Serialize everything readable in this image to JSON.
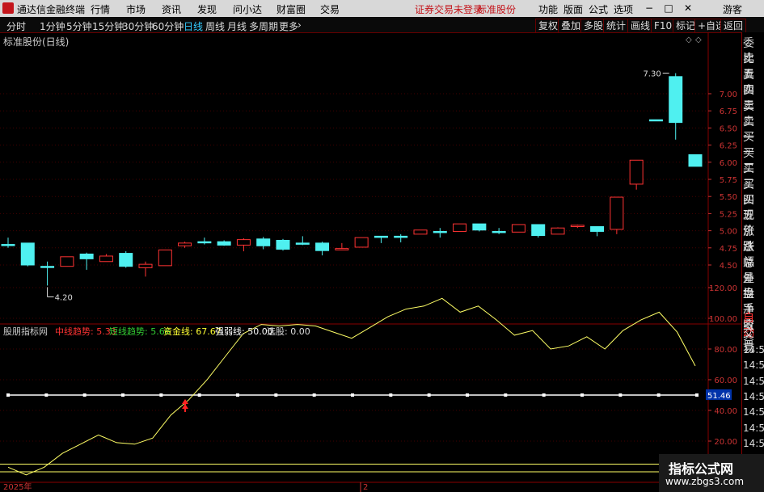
{
  "titlebar": {
    "app_name": "通达信金融终端",
    "menus": [
      "行情",
      "市场",
      "资讯",
      "发现",
      "问小达",
      "财富圈",
      "交易"
    ],
    "warning": "证券交易未登录",
    "stock_label": "标准股份",
    "right_menus": [
      "功能",
      "版面",
      "公式",
      "选项"
    ],
    "user": "游客"
  },
  "periods": {
    "items": [
      "分时",
      "1分钟",
      "5分钟",
      "15分钟",
      "30分钟",
      "60分钟",
      "日线",
      "周线",
      "月线",
      "多周期",
      "更多"
    ],
    "active": "日线"
  },
  "tools": [
    "复权",
    "叠加",
    "多股",
    "统计",
    "画线",
    "F10",
    "标记",
    "+自选",
    "返回"
  ],
  "stock_title": "标准股份(日线)",
  "right_panel": {
    "top_items": [
      "委比",
      "卖五",
      "卖四",
      "卖三",
      "卖二",
      "卖一",
      "买一",
      "买二",
      "买三",
      "买四",
      "买五",
      "现价",
      "涨跌",
      "涨幅",
      "总量",
      "外盘",
      "换手",
      "净资",
      "收益"
    ],
    "bottom_items": [
      "自动",
      "交易",
      "14:56",
      "14:56",
      "14:56",
      "14:56",
      "14:56",
      "14:56",
      "14:56",
      "14:56",
      "14:56"
    ]
  },
  "price_axis": [
    "7.00",
    "6.75",
    "6.50",
    "6.25",
    "6.00",
    "5.75",
    "5.50",
    "5.25",
    "5.00",
    "4.75",
    "4.50"
  ],
  "annotations": {
    "high": "7.30",
    "low": "4.20"
  },
  "indicator": {
    "name": "股朋指标网",
    "items": [
      {
        "label": "中线趋势: 5.33",
        "color": "#ff3333"
      },
      {
        "label": "短线趋势: 5.66",
        "color": "#33cc33"
      },
      {
        "label": "资金线: 67.67",
        "color": "#ffff33"
      },
      {
        "label": "强弱线: 50.00",
        "color": "#ffffff"
      },
      {
        "label": "选股: 0.00",
        "color": "#dddddd"
      }
    ],
    "axis": [
      "120.00",
      "100.00",
      "80.00",
      "60.00",
      "40.00",
      "20.00"
    ],
    "current": "51.46"
  },
  "date_labels": {
    "start": "2025年",
    "mid": "2"
  },
  "watermark": {
    "line1": "指标公式网",
    "line2": "www.zbgs3.com"
  },
  "chart_data": {
    "type": "candlestick",
    "candles": [
      {
        "o": 4.8,
        "c": 4.8,
        "h": 4.9,
        "l": 4.75,
        "up": false
      },
      {
        "o": 4.82,
        "c": 4.5,
        "h": 4.82,
        "l": 4.48,
        "up": false
      },
      {
        "o": 4.48,
        "c": 4.48,
        "h": 4.55,
        "l": 4.2,
        "up": false
      },
      {
        "o": 4.48,
        "c": 4.62,
        "h": 4.62,
        "l": 4.48,
        "up": true
      },
      {
        "o": 4.66,
        "c": 4.59,
        "h": 4.68,
        "l": 4.43,
        "up": false
      },
      {
        "o": 4.55,
        "c": 4.63,
        "h": 4.66,
        "l": 4.55,
        "up": true
      },
      {
        "o": 4.67,
        "c": 4.48,
        "h": 4.7,
        "l": 4.46,
        "up": false
      },
      {
        "o": 4.46,
        "c": 4.51,
        "h": 4.55,
        "l": 4.33,
        "up": true
      },
      {
        "o": 4.49,
        "c": 4.72,
        "h": 4.72,
        "l": 4.49,
        "up": true
      },
      {
        "o": 4.78,
        "c": 4.82,
        "h": 4.84,
        "l": 4.75,
        "up": true
      },
      {
        "o": 4.84,
        "c": 4.84,
        "h": 4.9,
        "l": 4.8,
        "up": false
      },
      {
        "o": 4.84,
        "c": 4.79,
        "h": 4.86,
        "l": 4.78,
        "up": false
      },
      {
        "o": 4.79,
        "c": 4.87,
        "h": 4.89,
        "l": 4.7,
        "up": true
      },
      {
        "o": 4.88,
        "c": 4.78,
        "h": 4.91,
        "l": 4.73,
        "up": false
      },
      {
        "o": 4.86,
        "c": 4.73,
        "h": 4.88,
        "l": 4.71,
        "up": false
      },
      {
        "o": 4.82,
        "c": 4.82,
        "h": 4.92,
        "l": 4.79,
        "up": false
      },
      {
        "o": 4.82,
        "c": 4.71,
        "h": 4.84,
        "l": 4.64,
        "up": false
      },
      {
        "o": 4.72,
        "c": 4.74,
        "h": 4.82,
        "l": 4.72,
        "up": true
      },
      {
        "o": 4.76,
        "c": 4.9,
        "h": 4.9,
        "l": 4.76,
        "up": true
      },
      {
        "o": 4.92,
        "c": 4.92,
        "h": 4.92,
        "l": 4.82,
        "up": false
      },
      {
        "o": 4.92,
        "c": 4.92,
        "h": 4.95,
        "l": 4.83,
        "up": false
      },
      {
        "o": 4.95,
        "c": 5.01,
        "h": 5.01,
        "l": 4.95,
        "up": true
      },
      {
        "o": 4.99,
        "c": 4.99,
        "h": 5.04,
        "l": 4.9,
        "up": false
      },
      {
        "o": 4.99,
        "c": 5.1,
        "h": 5.1,
        "l": 4.99,
        "up": true
      },
      {
        "o": 5.1,
        "c": 5.01,
        "h": 5.1,
        "l": 4.99,
        "up": false
      },
      {
        "o": 4.99,
        "c": 4.99,
        "h": 5.04,
        "l": 4.95,
        "up": false
      },
      {
        "o": 4.98,
        "c": 5.09,
        "h": 5.09,
        "l": 4.98,
        "up": true
      },
      {
        "o": 5.09,
        "c": 4.93,
        "h": 5.09,
        "l": 4.9,
        "up": false
      },
      {
        "o": 4.95,
        "c": 5.04,
        "h": 5.05,
        "l": 4.95,
        "up": true
      },
      {
        "o": 5.06,
        "c": 5.08,
        "h": 5.09,
        "l": 5.04,
        "up": true
      },
      {
        "o": 5.06,
        "c": 4.99,
        "h": 5.06,
        "l": 4.92,
        "up": false
      },
      {
        "o": 5.02,
        "c": 5.49,
        "h": 5.49,
        "l": 4.95,
        "up": true
      },
      {
        "o": 5.68,
        "c": 6.03,
        "h": 6.03,
        "l": 5.6,
        "up": true
      },
      {
        "o": 6.62,
        "c": 6.62,
        "h": 6.62,
        "l": 6.62,
        "up": false
      },
      {
        "o": 7.25,
        "c": 6.58,
        "h": 7.3,
        "l": 6.33,
        "up": false
      },
      {
        "o": 6.11,
        "c": 5.94,
        "h": 6.11,
        "l": 5.94,
        "up": false
      }
    ],
    "ylim": [
      4.0,
      7.5
    ],
    "indicator_series": {
      "name": "资金线",
      "values": [
        3,
        -2,
        3,
        12,
        18,
        24,
        19,
        18,
        22,
        37,
        47,
        60,
        75,
        90,
        96,
        95,
        96,
        95,
        91,
        87,
        94,
        101,
        106,
        108,
        113,
        104,
        108,
        99,
        89,
        92,
        80,
        82,
        88,
        80,
        92,
        99,
        104,
        91,
        69
      ],
      "strength_line": 50,
      "ylim": [
        -5,
        130
      ],
      "band_lines": [
        0,
        5
      ]
    }
  }
}
